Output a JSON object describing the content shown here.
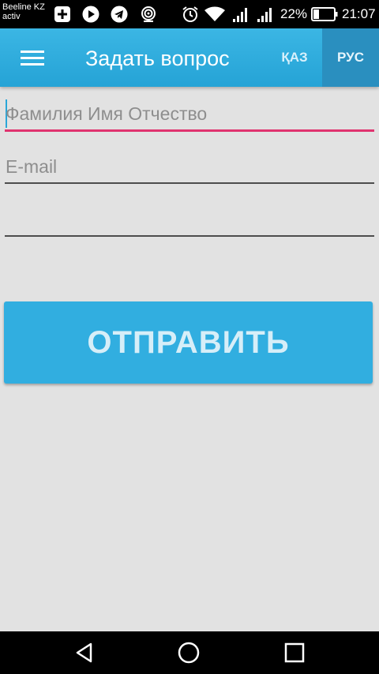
{
  "status_bar": {
    "carrier_line1": "Beeline KZ",
    "carrier_line2": "activ",
    "battery_percent": "22%",
    "time": "21:07",
    "icons": [
      "plus-box-icon",
      "play-icon",
      "telegram-icon",
      "hotspot-icon",
      "alarm-icon",
      "wifi-icon",
      "signal-1-icon",
      "signal-2-icon",
      "battery-icon"
    ]
  },
  "app_bar": {
    "title": "Задать вопрос",
    "lang_kaz": "ҚАЗ",
    "lang_rus": "РУС",
    "active_lang": "РУС",
    "accent_color": "#31aee0"
  },
  "form": {
    "name_placeholder": "Фамилия Имя Отчество",
    "name_value": "",
    "email_placeholder": "E-mail",
    "email_value": "",
    "question_placeholder": "",
    "question_value": "",
    "submit_label": "ОТПРАВИТЬ",
    "focus_underline_color": "#e0336f"
  },
  "nav_bar": {
    "icons": [
      "back-icon",
      "home-icon",
      "recents-icon"
    ]
  }
}
